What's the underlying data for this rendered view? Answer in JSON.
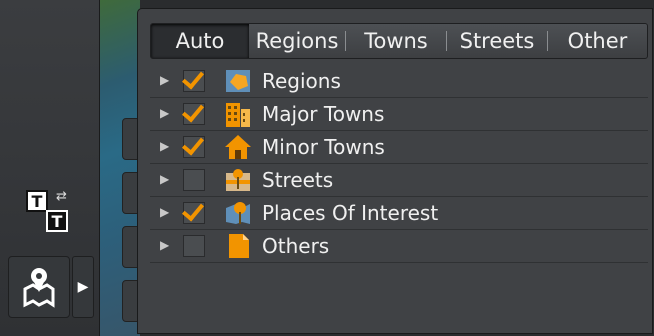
{
  "tabs": [
    "Auto",
    "Regions",
    "Towns",
    "Streets",
    "Other"
  ],
  "active_tab": "Auto",
  "layers": [
    {
      "label": "Regions",
      "checked": true,
      "icon": "regions-icon"
    },
    {
      "label": "Major Towns",
      "checked": true,
      "icon": "major-towns-icon"
    },
    {
      "label": "Minor Towns",
      "checked": true,
      "icon": "minor-towns-icon"
    },
    {
      "label": "Streets",
      "checked": false,
      "icon": "streets-icon"
    },
    {
      "label": "Places Of Interest",
      "checked": true,
      "icon": "places-of-interest-icon"
    },
    {
      "label": "Others",
      "checked": false,
      "icon": "others-icon"
    }
  ],
  "colors": {
    "check": "#f29400",
    "panel": "#404245"
  }
}
